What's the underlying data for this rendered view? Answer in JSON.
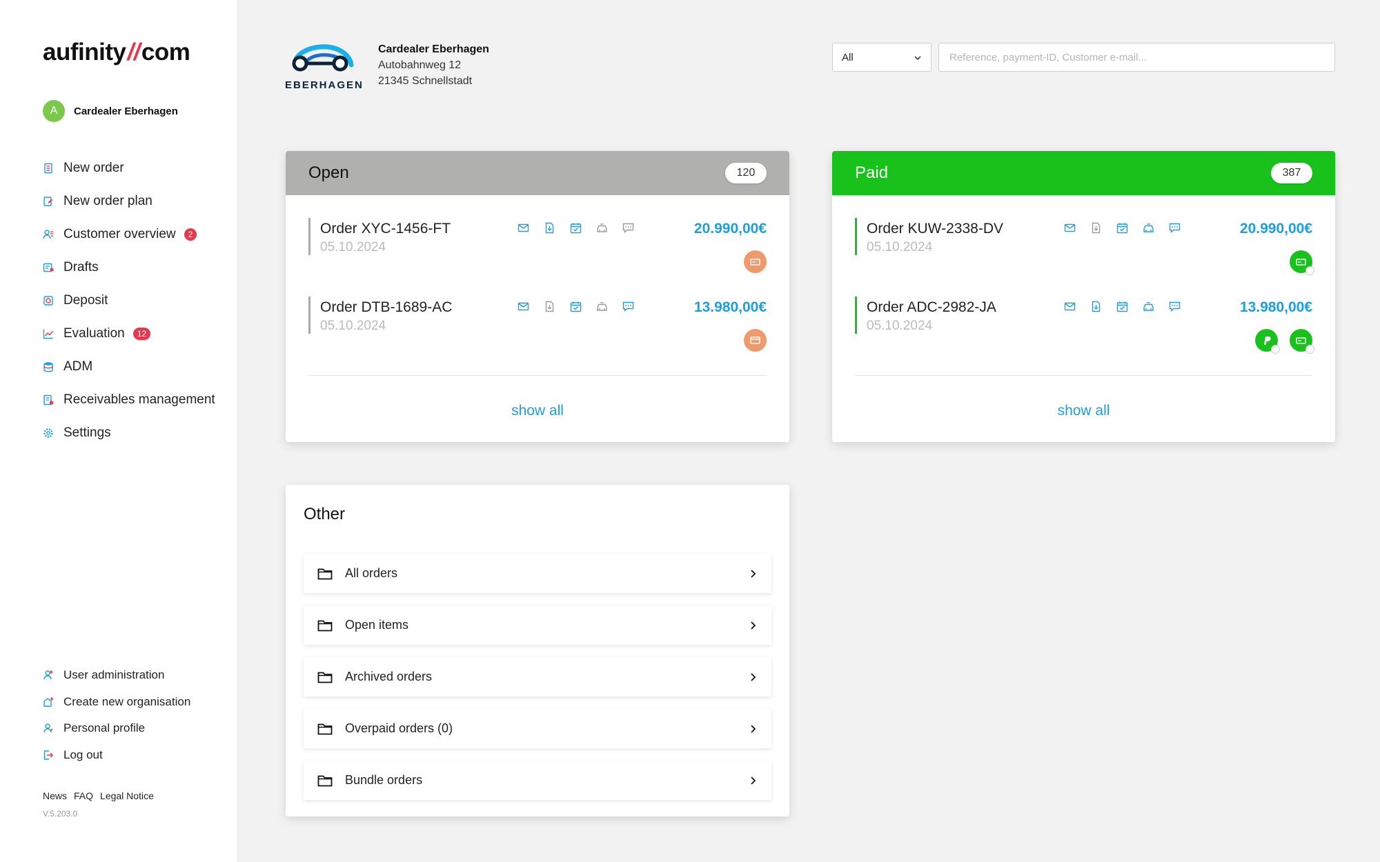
{
  "brand": {
    "logo_left": "aufinity",
    "logo_slash": "//",
    "logo_right": "com"
  },
  "account": {
    "initial": "A",
    "name": "Cardealer Eberhagen"
  },
  "nav": [
    {
      "label": "New order",
      "icon": "document-icon"
    },
    {
      "label": "New order plan",
      "icon": "edit-document-icon"
    },
    {
      "label": "Customer overview",
      "icon": "customers-icon",
      "badge": "2"
    },
    {
      "label": "Drafts",
      "icon": "drafts-icon"
    },
    {
      "label": "Deposit",
      "icon": "deposit-icon"
    },
    {
      "label": "Evaluation",
      "icon": "chart-icon",
      "badge": "12"
    },
    {
      "label": "ADM",
      "icon": "database-icon"
    },
    {
      "label": "Receivables management",
      "icon": "receivables-icon"
    },
    {
      "label": "Settings",
      "icon": "gear-icon"
    }
  ],
  "nav_secondary": [
    {
      "label": "User administration",
      "icon": "user-admin-icon"
    },
    {
      "label": "Create new organisation",
      "icon": "organisation-icon"
    },
    {
      "label": "Personal profile",
      "icon": "profile-icon"
    },
    {
      "label": "Log out",
      "icon": "logout-icon"
    }
  ],
  "footer": {
    "news": "News",
    "faq": "FAQ",
    "legal": "Legal Notice",
    "version": "V.5.203.0"
  },
  "dealer": {
    "logo_word": "EBERHAGEN",
    "name": "Cardealer Eberhagen",
    "street": "Autobahnweg 12",
    "city": "21345 Schnellstadt"
  },
  "filter": {
    "selected": "All",
    "search_placeholder": "Reference, payment-ID, Customer e-mail..."
  },
  "open_card": {
    "title": "Open",
    "count": "120",
    "header_color": "#b0b0ae",
    "orders": [
      {
        "name": "Order XYC-1456-FT",
        "date": "05.10.2024",
        "amount": "20.990,00€"
      },
      {
        "name": "Order DTB-1689-AC",
        "date": "05.10.2024",
        "amount": "13.980,00€"
      }
    ],
    "show_all": "show all"
  },
  "paid_card": {
    "title": "Paid",
    "count": "387",
    "header_color": "#19c21a",
    "orders": [
      {
        "name": "Order KUW-2338-DV",
        "date": "05.10.2024",
        "amount": "20.990,00€"
      },
      {
        "name": "Order ADC-2982-JA",
        "date": "05.10.2024",
        "amount": "13.980,00€"
      }
    ],
    "show_all": "show all"
  },
  "other_card": {
    "title": "Other",
    "items": [
      {
        "label": "All orders"
      },
      {
        "label": "Open items"
      },
      {
        "label": "Archived orders"
      },
      {
        "label": "Overpaid orders (0)"
      },
      {
        "label": "Bundle orders"
      }
    ]
  },
  "colors": {
    "accent": "#1a9fe0",
    "badge": "#e8384f",
    "open_pay": "#ef9a6c",
    "paid_green": "#19c21a",
    "muted_icon": "#9a9a9a"
  }
}
